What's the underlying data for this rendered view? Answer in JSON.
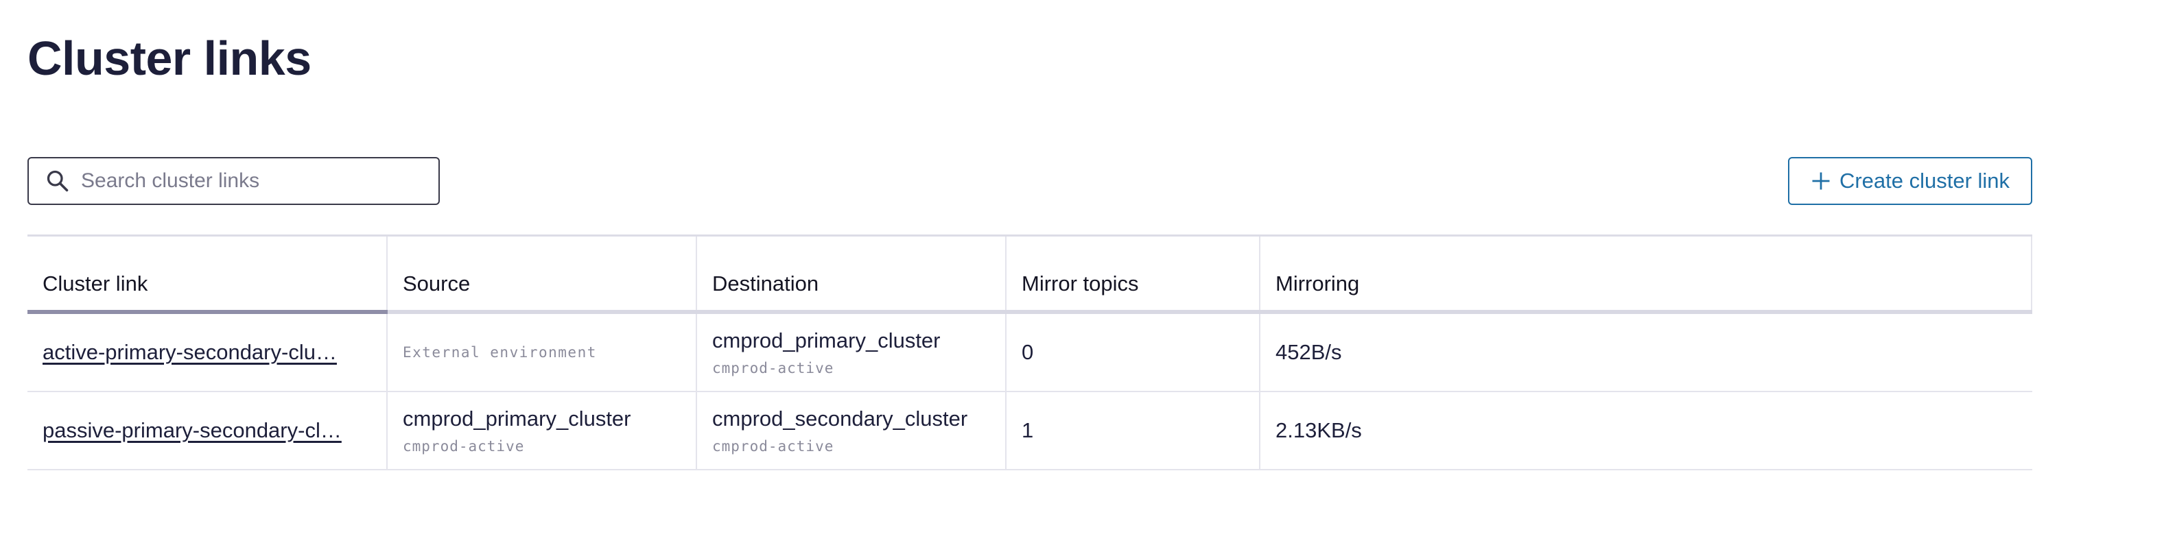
{
  "page": {
    "title": "Cluster links"
  },
  "search": {
    "placeholder": "Search cluster links",
    "value": "",
    "icon": "search-icon"
  },
  "toolbar": {
    "create_label": "Create cluster link",
    "create_icon": "plus-icon",
    "accent": "#1f6fa6"
  },
  "table": {
    "columns": [
      "Cluster link",
      "Source",
      "Destination",
      "Mirror topics",
      "Mirroring"
    ],
    "sorted_column": "Cluster link",
    "rows": [
      {
        "cluster_link": "active-primary-secondary-clu…",
        "source": {
          "name": "",
          "env": "External environment"
        },
        "destination": {
          "name": "cmprod_primary_cluster",
          "env": "cmprod-active"
        },
        "mirror_topics": "0",
        "mirroring": "452B/s"
      },
      {
        "cluster_link": "passive-primary-secondary-cl…",
        "source": {
          "name": "cmprod_primary_cluster",
          "env": "cmprod-active"
        },
        "destination": {
          "name": "cmprod_secondary_cluster",
          "env": "cmprod-active"
        },
        "mirror_topics": "1",
        "mirroring": "2.13KB/s"
      }
    ]
  }
}
